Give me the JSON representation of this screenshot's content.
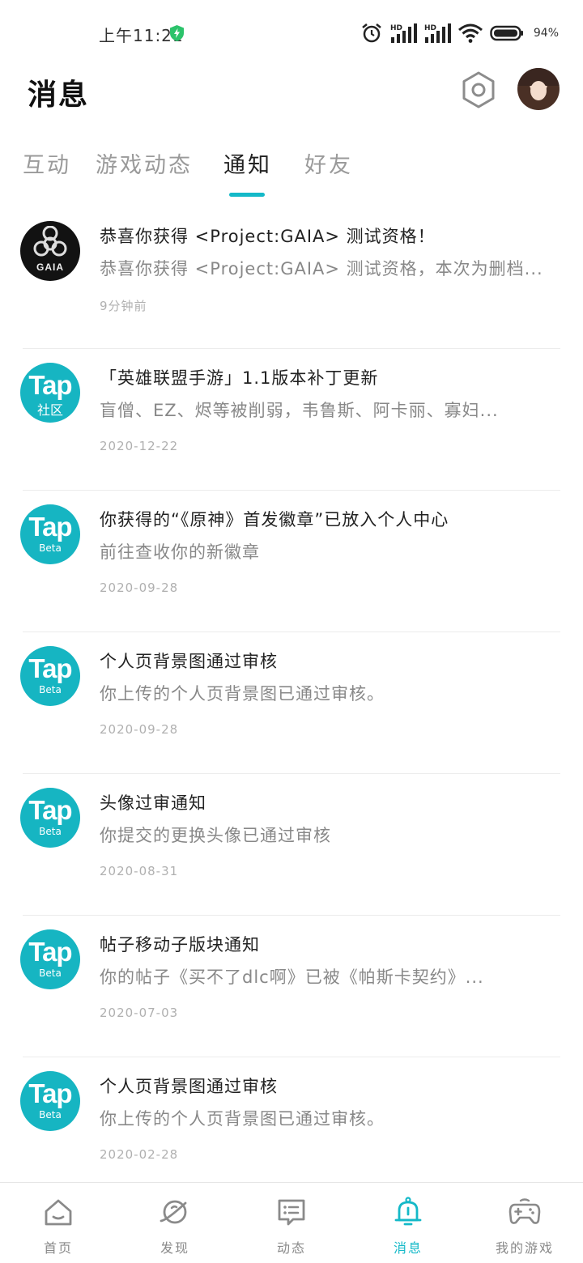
{
  "status_bar": {
    "time": "上午11:21",
    "battery": "94%"
  },
  "header": {
    "title": "消息"
  },
  "tabs": [
    {
      "label": "互动"
    },
    {
      "label": "游戏动态"
    },
    {
      "label": "通知"
    },
    {
      "label": "好友"
    }
  ],
  "active_tab": "通知",
  "notifications": [
    {
      "logo": "gaia-logo",
      "logo_text": "GAIA",
      "title": "恭喜你获得 <Project:GAIA> 测试资格！",
      "body": "恭喜你获得 <Project:GAIA> 测试资格，本次为删档...",
      "time": "9分钟前"
    },
    {
      "logo": "tap-community-logo",
      "logo_text": "Tap",
      "logo_sub": "社区",
      "title": "「英雄联盟手游」1.1版本补丁更新",
      "body": "盲僧、EZ、烬等被削弱，韦鲁斯、阿卡丽、寡妇...",
      "time": "2020-12-22"
    },
    {
      "logo": "tap-beta-logo",
      "logo_text": "Tap",
      "logo_sub": "Beta",
      "title": "你获得的“《原神》首发徽章”已放入个人中心",
      "body": "前往查收你的新徽章",
      "time": "2020-09-28"
    },
    {
      "logo": "tap-beta-logo",
      "logo_text": "Tap",
      "logo_sub": "Beta",
      "title": "个人页背景图通过审核",
      "body": "你上传的个人页背景图已通过审核。",
      "time": "2020-09-28"
    },
    {
      "logo": "tap-beta-logo",
      "logo_text": "Tap",
      "logo_sub": "Beta",
      "title": "头像过审通知",
      "body": "你提交的更换头像已通过审核",
      "time": "2020-08-31"
    },
    {
      "logo": "tap-beta-logo",
      "logo_text": "Tap",
      "logo_sub": "Beta",
      "title": "帖子移动子版块通知",
      "body": "你的帖子《买不了dlc啊》已被《帕斯卡契约》...",
      "time": "2020-07-03"
    },
    {
      "logo": "tap-beta-logo",
      "logo_text": "Tap",
      "logo_sub": "Beta",
      "title": "个人页背景图通过审核",
      "body": "你上传的个人页背景图已通过审核。",
      "time": "2020-02-28"
    }
  ],
  "bottom_nav": [
    {
      "label": "首页",
      "icon": "home-icon"
    },
    {
      "label": "发现",
      "icon": "planet-icon"
    },
    {
      "label": "动态",
      "icon": "feed-icon"
    },
    {
      "label": "消息",
      "icon": "bell-icon"
    },
    {
      "label": "我的游戏",
      "icon": "gamepad-icon"
    }
  ],
  "colors": {
    "accent": "#14b9c8",
    "tap_logo": "#16b5c2"
  }
}
